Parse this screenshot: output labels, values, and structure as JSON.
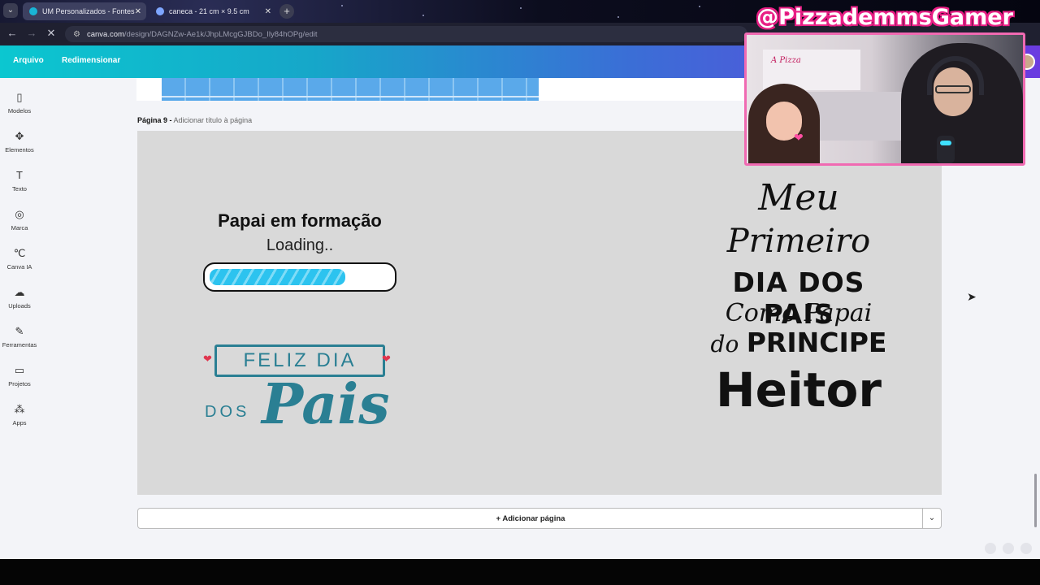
{
  "browser": {
    "tabs": [
      {
        "title": "UM Personalizados - Fontes -",
        "active": true
      },
      {
        "title": "caneca - 21 cm × 9.5 cm",
        "active": false
      }
    ],
    "url_host": "canva.com",
    "url_path": "/design/DAGNZw-Ae1k/JhpLMcgGJBDo_Ily84hOPg/edit"
  },
  "header": {
    "file_label": "Arquivo",
    "resize_label": "Redimensionar"
  },
  "sidebar": {
    "items": [
      {
        "label": "Modelos",
        "icon": "▯"
      },
      {
        "label": "Elementos",
        "icon": "✥"
      },
      {
        "label": "Texto",
        "icon": "T"
      },
      {
        "label": "Marca",
        "icon": "◎"
      },
      {
        "label": "Canva IA",
        "icon": "℃"
      },
      {
        "label": "Uploads",
        "icon": "☁"
      },
      {
        "label": "Ferramentas",
        "icon": "✎"
      },
      {
        "label": "Projetos",
        "icon": "▭"
      },
      {
        "label": "Apps",
        "icon": "⁂"
      }
    ]
  },
  "page": {
    "label_number": "Página 9 -",
    "label_hint": "Adicionar título à página",
    "left_design": {
      "title": "Papai em formação",
      "loading": "Loading..",
      "progress": 0.75
    },
    "feliz": {
      "banner": "FELIZ DIA",
      "dos": "DOS",
      "pais": "Pais"
    },
    "right_design": {
      "line1": "Meu",
      "line2": "Primeiro",
      "line3": "DIA DOS PAIS",
      "line4": "Como Papai",
      "line5_small": "do",
      "line5_big": "PRINCIPE",
      "line6": "Heitor"
    }
  },
  "add_page": {
    "label": "+ Adicionar página"
  },
  "overlay": {
    "handle": "@PizzademmsGamer",
    "shelf_text": "A Pizza"
  },
  "colors": {
    "teal": "#2a7f93",
    "progress_blue": "#2cc3ef",
    "overlay_pink": "#e91e85"
  }
}
